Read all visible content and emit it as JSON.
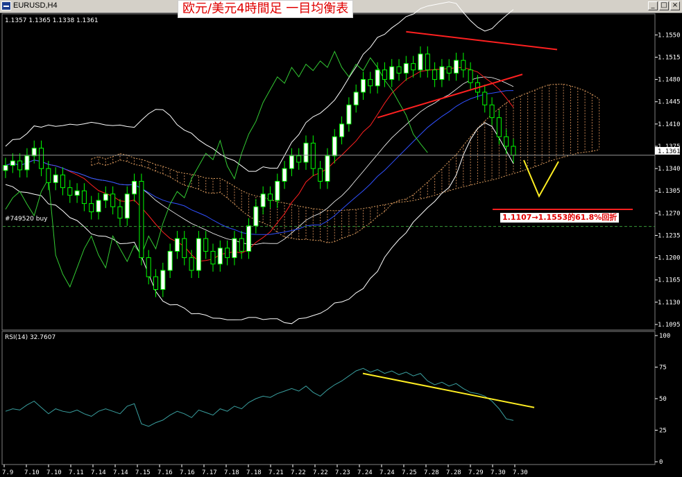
{
  "window": {
    "title": "EURUSD,H4",
    "minimize_glyph": "_",
    "restore_glyph": "□",
    "close_glyph": "×",
    "icon": "chart-window-icon"
  },
  "banner": {
    "text": "欧元/美元4時間足 一目均衡表"
  },
  "annotation": {
    "fib_text": "1.1107→1.1553的61.8%回折"
  },
  "chart_data": [
    {
      "type": "candlestick",
      "symbol": "EURUSD",
      "timeframe": "H4",
      "ohlc_label": "1.1357 1.1365 1.1338 1.1361",
      "current_price": "1.1361",
      "order_label": "#749520 buy",
      "order_price": 1.1249,
      "ylim": [
        1.1095,
        1.157
      ],
      "yticks": [
        "1.1550",
        "1.1515",
        "1.1480",
        "1.1445",
        "1.1410",
        "1.1375",
        "1.1340",
        "1.1305",
        "1.1270",
        "1.1235",
        "1.1200",
        "1.1165",
        "1.1130",
        "1.1095"
      ],
      "xticks": [
        "7.9",
        "7.10",
        "7.10",
        "7.11",
        "7.14",
        "7.14",
        "7.15",
        "7.16",
        "7.16",
        "7.17",
        "7.18",
        "7.18",
        "7.21",
        "7.22",
        "7.22",
        "7.23",
        "7.24",
        "7.24",
        "7.25",
        "7.28",
        "7.28",
        "7.29",
        "7.30",
        "7.30"
      ],
      "closes": [
        1.1345,
        1.1352,
        1.1338,
        1.136,
        1.1372,
        1.134,
        1.1318,
        1.133,
        1.131,
        1.1298,
        1.1305,
        1.1285,
        1.1272,
        1.129,
        1.13,
        1.128,
        1.1262,
        1.13,
        1.132,
        1.12,
        1.117,
        1.115,
        1.118,
        1.121,
        1.123,
        1.12,
        1.118,
        1.123,
        1.121,
        1.119,
        1.1215,
        1.12,
        1.123,
        1.121,
        1.125,
        1.128,
        1.13,
        1.129,
        1.132,
        1.134,
        1.136,
        1.135,
        1.138,
        1.134,
        1.132,
        1.136,
        1.139,
        1.141,
        1.144,
        1.146,
        1.148,
        1.147,
        1.1495,
        1.148,
        1.15,
        1.149,
        1.1505,
        1.1495,
        1.152,
        1.1495,
        1.148,
        1.15,
        1.149,
        1.151,
        1.1495,
        1.1475,
        1.146,
        1.144,
        1.142,
        1.139,
        1.1375,
        1.1361
      ]
    },
    {
      "type": "line",
      "name": "RSI(14)",
      "label": "RSI(14)  32.7607",
      "ylim": [
        0,
        100
      ],
      "yticks": [
        "100",
        "75",
        "50",
        "25",
        "0"
      ],
      "values": [
        40,
        42,
        41,
        45,
        48,
        43,
        38,
        42,
        40,
        39,
        41,
        38,
        36,
        40,
        42,
        40,
        38,
        44,
        46,
        30,
        28,
        31,
        33,
        37,
        40,
        38,
        35,
        41,
        39,
        37,
        42,
        40,
        44,
        42,
        47,
        50,
        52,
        51,
        54,
        56,
        58,
        56,
        60,
        55,
        52,
        57,
        61,
        64,
        68,
        72,
        74,
        71,
        73,
        70,
        72,
        69,
        71,
        68,
        70,
        64,
        61,
        63,
        60,
        62,
        58,
        55,
        54,
        52,
        48,
        42,
        34,
        32.76
      ]
    }
  ]
}
